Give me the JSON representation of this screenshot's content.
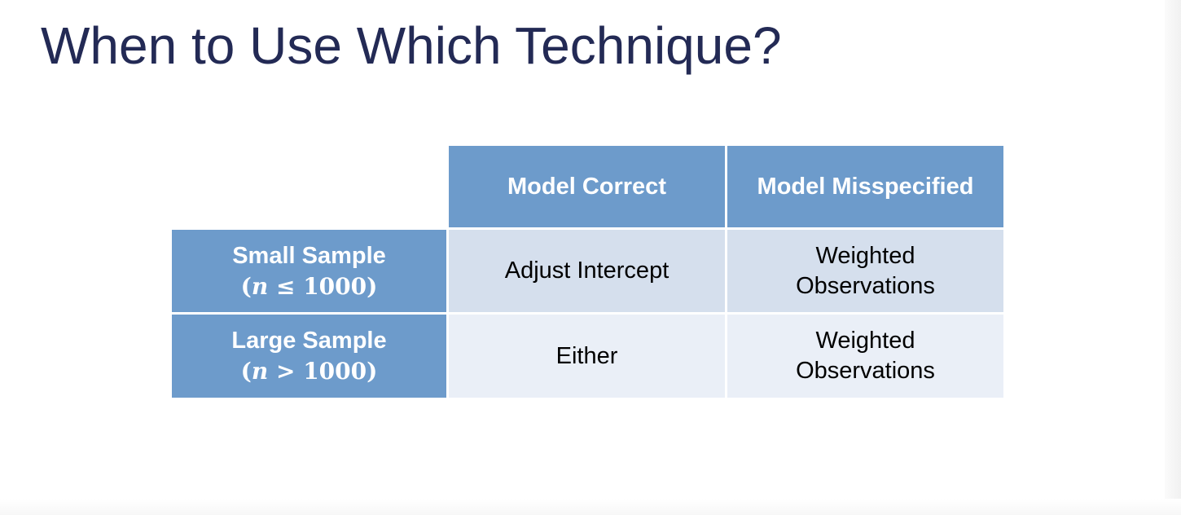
{
  "slide": {
    "title": "When to Use Which Technique?"
  },
  "table": {
    "columns": [
      "Model Correct",
      "Model Misspecified"
    ],
    "rows": [
      {
        "label": "Small Sample",
        "condition": {
          "open": "(",
          "var": "n",
          "rest": " ≤ 1000)"
        },
        "cells": [
          [
            "Adjust Intercept"
          ],
          [
            "Weighted",
            "Observations"
          ]
        ]
      },
      {
        "label": "Large Sample",
        "condition": {
          "open": "(",
          "var": "n",
          "rest": " > 1000)"
        },
        "cells": [
          [
            "Either"
          ],
          [
            "Weighted",
            "Observations"
          ]
        ]
      }
    ]
  },
  "colors": {
    "title": "#232a55",
    "header_fill": "#6d9bcb",
    "row_fill_1": "#d5dfed",
    "row_fill_2": "#eaeff7"
  }
}
